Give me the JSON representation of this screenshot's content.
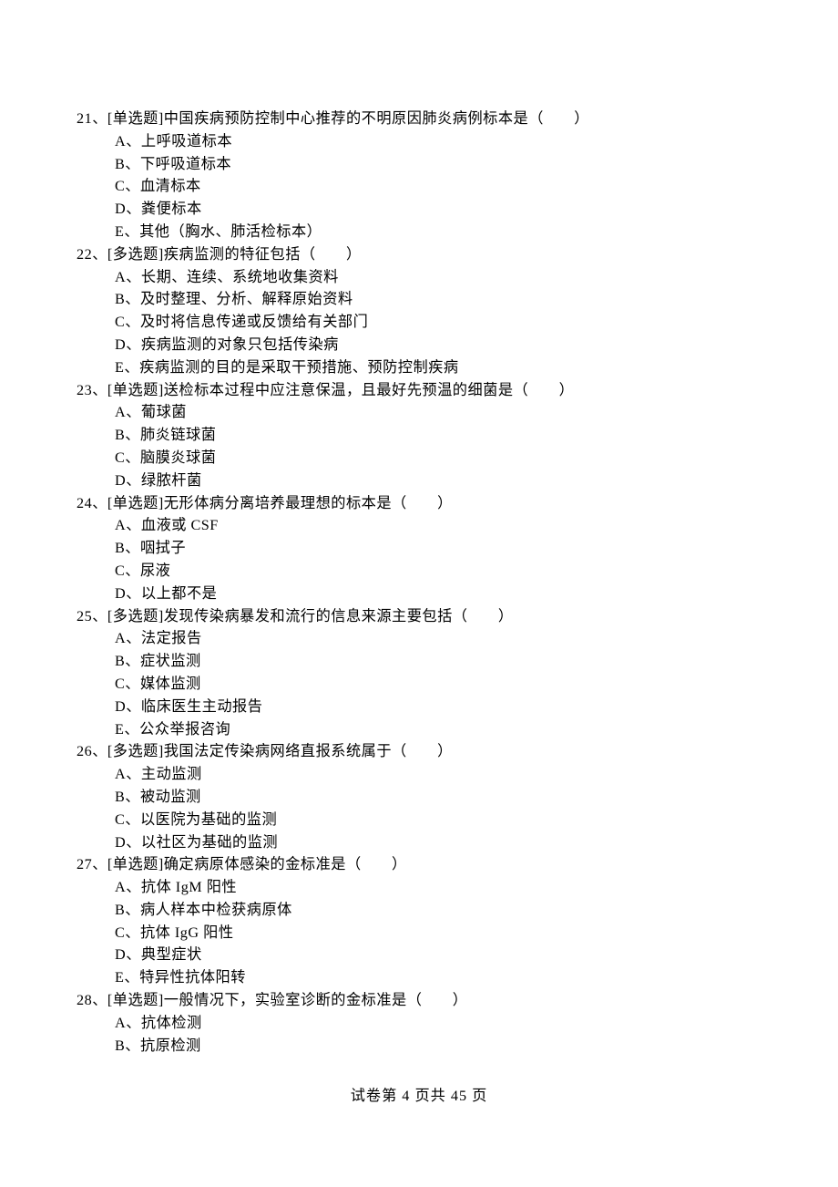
{
  "questions": [
    {
      "number": "21、",
      "type": "[单选题]",
      "stem": "中国疾病预防控制中心推荐的不明原因肺炎病例标本是（　　）",
      "options": [
        "A、上呼吸道标本",
        "B、下呼吸道标本",
        "C、血清标本",
        "D、粪便标本",
        "E、其他（胸水、肺活检标本）"
      ]
    },
    {
      "number": "22、",
      "type": "[多选题]",
      "stem": "疾病监测的特征包括（　　）",
      "options": [
        "A、长期、连续、系统地收集资料",
        "B、及时整理、分析、解释原始资料",
        "C、及时将信息传递或反馈给有关部门",
        "D、疾病监测的对象只包括传染病",
        "E、疾病监测的目的是采取干预措施、预防控制疾病"
      ]
    },
    {
      "number": "23、",
      "type": "[单选题]",
      "stem": "送检标本过程中应注意保温，且最好先预温的细菌是（　　）",
      "options": [
        "A、葡球菌",
        "B、肺炎链球菌",
        "C、脑膜炎球菌",
        "D、绿脓杆菌"
      ]
    },
    {
      "number": "24、",
      "type": "[单选题]",
      "stem": "无形体病分离培养最理想的标本是（　　）",
      "options": [
        "A、血液或 CSF",
        "B、咽拭子",
        "C、尿液",
        "D、以上都不是"
      ]
    },
    {
      "number": "25、",
      "type": "[多选题]",
      "stem": "发现传染病暴发和流行的信息来源主要包括（　　）",
      "options": [
        "A、法定报告",
        "B、症状监测",
        "C、媒体监测",
        "D、临床医生主动报告",
        "E、公众举报咨询"
      ]
    },
    {
      "number": "26、",
      "type": "[多选题]",
      "stem": "我国法定传染病网络直报系统属于（　　）",
      "options": [
        "A、主动监测",
        "B、被动监测",
        "C、以医院为基础的监测",
        "D、以社区为基础的监测"
      ]
    },
    {
      "number": "27、",
      "type": "[单选题]",
      "stem": "确定病原体感染的金标准是（　　）",
      "options": [
        "A、抗体 IgM 阳性",
        "B、病人样本中检获病原体",
        "C、抗体 IgG 阳性",
        "D、典型症状",
        "E、特异性抗体阳转"
      ]
    },
    {
      "number": "28、",
      "type": "[单选题]",
      "stem": "一般情况下，实验室诊断的金标准是（　　）",
      "options": [
        "A、抗体检测",
        "B、抗原检测"
      ]
    }
  ],
  "footer": "试卷第 4 页共 45 页"
}
